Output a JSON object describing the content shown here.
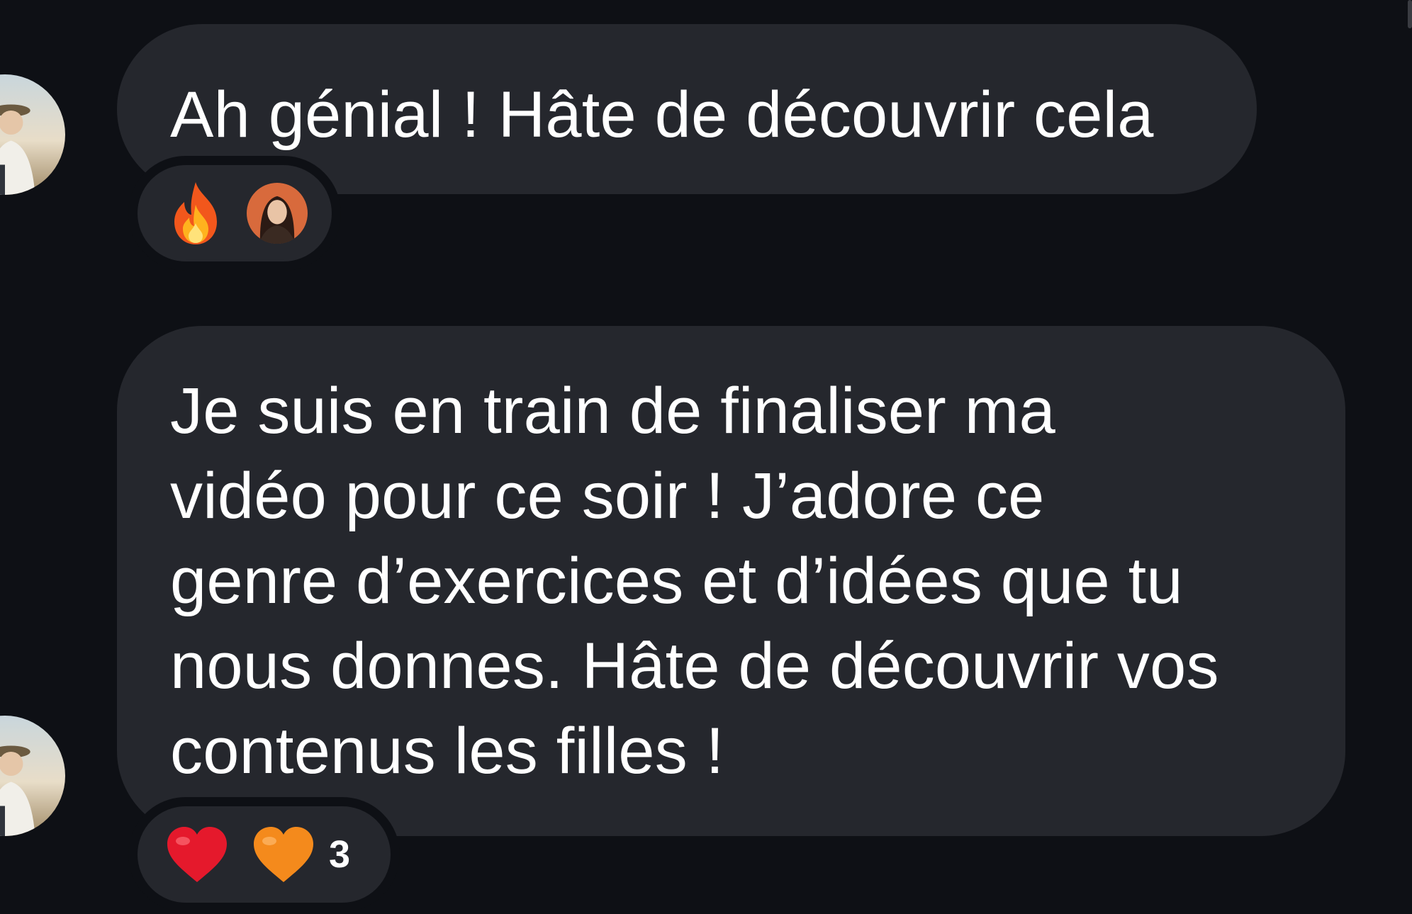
{
  "messages": [
    {
      "text": "Ah génial ! Hâte de découvrir cela",
      "avatar_icon": "user-avatar-photo",
      "reactions": [
        {
          "icon": "fire-emoji-icon"
        },
        {
          "icon": "reactor-avatar-photo"
        }
      ],
      "reaction_count": ""
    },
    {
      "text": "Je suis en train de finaliser ma\nvidéo pour ce soir ! J’adore ce\ngenre d’exercices et d’idées que tu\nnous donnes. Hâte de découvrir vos\ncontenus les filles !",
      "avatar_icon": "user-avatar-photo",
      "reactions": [
        {
          "icon": "red-heart-emoji-icon"
        },
        {
          "icon": "orange-heart-emoji-icon"
        }
      ],
      "reaction_count": "3"
    }
  ],
  "colors": {
    "background": "#0e1015",
    "bubble": "#25272d",
    "text": "#ffffff"
  }
}
